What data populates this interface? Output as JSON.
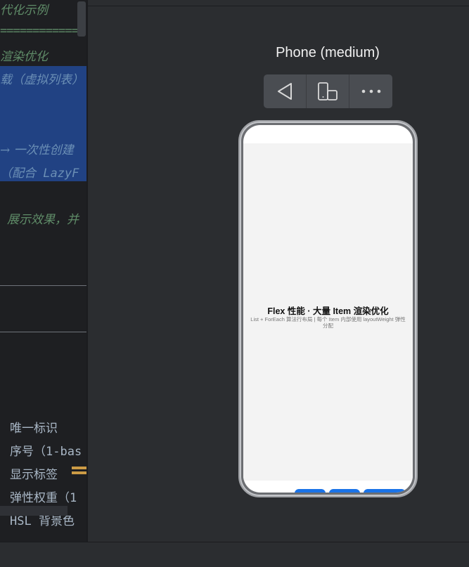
{
  "editor": {
    "lines": [
      "代化示例",
      "=============",
      "渲染优化",
      "载（虚拟列表）",
      "→ 一次性创建",
      "（配合 LazyF",
      "展示效果，并"
    ],
    "fields": [
      "唯一标识",
      "序号（1-bas",
      "显示标签",
      "弹性权重（1",
      "HSL 背景色"
    ]
  },
  "preview": {
    "device_title": "Phone (medium)",
    "toolbar": {
      "icons": [
        "back-triangle-icon",
        "device-rotate-icon",
        "more-dots-icon"
      ]
    },
    "app": {
      "title": "Flex 性能 · 大量 Item 渲染优化",
      "subtitle": "List + ForEach 算法行布局 | 每个 Item 内部使用 layoutWeight 弹性分配"
    },
    "tab_color": "#1a73e8"
  }
}
